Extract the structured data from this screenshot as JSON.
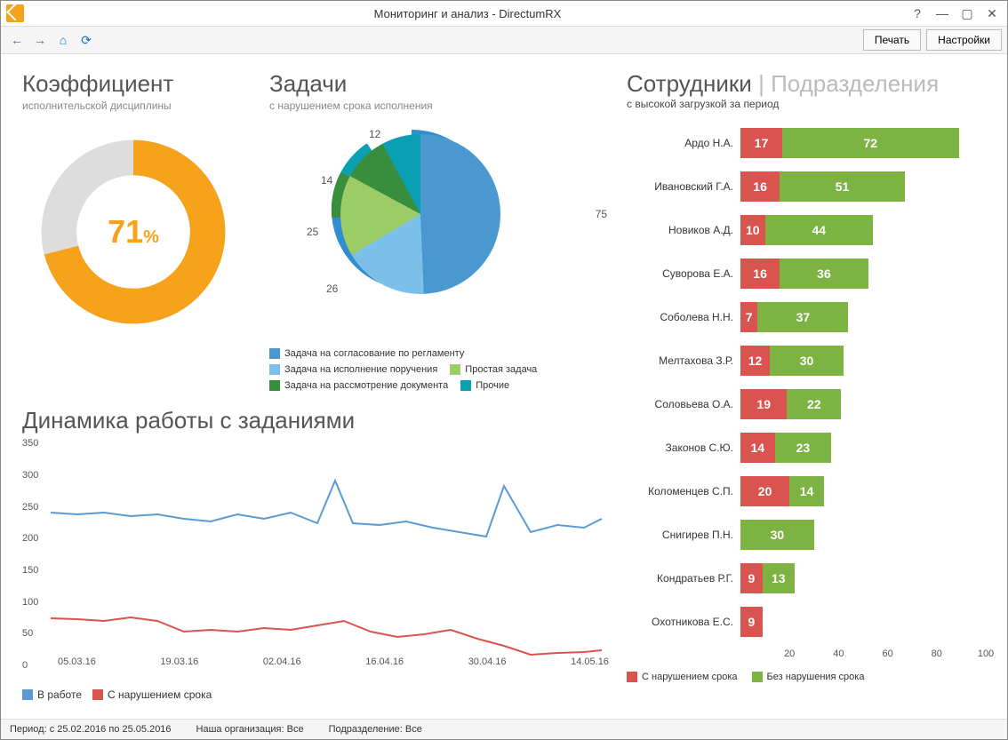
{
  "window": {
    "title": "Мониторинг и анализ - DirectumRX"
  },
  "toolbar": {
    "print_label": "Печать",
    "settings_label": "Настройки"
  },
  "coeff": {
    "title": "Коэффициент",
    "subtitle": "исполнительской дисциплины",
    "value": "71",
    "pct": "%"
  },
  "tasks": {
    "title": "Задачи",
    "subtitle": "с нарушением срока исполнения",
    "legend": [
      "Задача на согласование по регламенту",
      "Задача на исполнение поручения",
      "Простая задача",
      "Задача на рассмотрение документа",
      "Прочие"
    ]
  },
  "dynamics": {
    "title": "Динамика работы с заданиями",
    "legend": [
      "В работе",
      "С нарушением срока"
    ],
    "yticks": [
      "0",
      "50",
      "100",
      "150",
      "200",
      "250",
      "300",
      "350"
    ],
    "xticks": [
      "05.03.16",
      "19.03.16",
      "02.04.16",
      "16.04.16",
      "30.04.16",
      "14.05.16"
    ]
  },
  "employees": {
    "title": "Сотрудники",
    "tab2": "Подразделения",
    "subtitle": "с высокой загрузкой за период",
    "legend": [
      "С нарушением срока",
      "Без нарушения срока"
    ],
    "xticks": [
      "20",
      "40",
      "60",
      "80",
      "100"
    ],
    "rows": [
      {
        "name": "Ардо Н.А.",
        "red": 17,
        "green": 72
      },
      {
        "name": "Ивановский Г.А.",
        "red": 16,
        "green": 51
      },
      {
        "name": "Новиков А.Д.",
        "red": 10,
        "green": 44
      },
      {
        "name": "Суворова Е.А.",
        "red": 16,
        "green": 36
      },
      {
        "name": "Соболева Н.Н.",
        "red": 7,
        "green": 37
      },
      {
        "name": "Мелтахова З.Р.",
        "red": 12,
        "green": 30
      },
      {
        "name": "Соловьева О.А.",
        "red": 19,
        "green": 22
      },
      {
        "name": "Законов С.Ю.",
        "red": 14,
        "green": 23
      },
      {
        "name": "Коломенцев С.П.",
        "red": 20,
        "green": 14
      },
      {
        "name": "Снигирев П.Н.",
        "red": 0,
        "green": 30
      },
      {
        "name": "Кондратьев Р.Г.",
        "red": 9,
        "green": 13
      },
      {
        "name": "Охотникова Е.С.",
        "red": 9,
        "green": 0
      }
    ]
  },
  "statusbar": {
    "period": "Период: с 25.02.2016 по 25.05.2016",
    "org": "Наша организация: Все",
    "dept": "Подразделение: Все"
  },
  "chart_data": [
    {
      "type": "pie",
      "title": "Коэффициент исполнительской дисциплины",
      "series": [
        {
          "name": "donut",
          "values": [
            71,
            29
          ]
        }
      ],
      "note": "donut gauge; 71% completion"
    },
    {
      "type": "pie",
      "title": "Задачи с нарушением срока исполнения",
      "categories": [
        "Задача на согласование по регламенту",
        "Задача на исполнение поручения",
        "Простая задача",
        "Задача на рассмотрение документа",
        "Прочие"
      ],
      "values": [
        75,
        26,
        25,
        14,
        12
      ]
    },
    {
      "type": "line",
      "title": "Динамика работы с заданиями",
      "x": [
        "05.03.16",
        "19.03.16",
        "02.04.16",
        "16.04.16",
        "30.04.16",
        "14.05.16"
      ],
      "series": [
        {
          "name": "В работе",
          "values": [
            240,
            240,
            230,
            235,
            230,
            290,
            220,
            225,
            200,
            280,
            215
          ],
          "note": "approximate envelope, fluctuating around 200-250 with spikes near 290 and 283"
        },
        {
          "name": "С нарушением срока",
          "values": [
            75,
            72,
            55,
            55,
            60,
            65,
            55,
            50,
            30,
            15,
            20
          ],
          "note": "approximate, declining from ~75 to ~20"
        }
      ],
      "ylim": [
        0,
        350
      ]
    },
    {
      "type": "bar",
      "title": "Сотрудники с высокой загрузкой за период",
      "orientation": "horizontal-stacked",
      "categories": [
        "Ардо Н.А.",
        "Ивановский Г.А.",
        "Новиков А.Д.",
        "Суворова Е.А.",
        "Соболева Н.Н.",
        "Мелтахова З.Р.",
        "Соловьева О.А.",
        "Законов С.Ю.",
        "Коломенцев С.П.",
        "Снигирев П.Н.",
        "Кондратьев Р.Г.",
        "Охотникова Е.С."
      ],
      "series": [
        {
          "name": "С нарушением срока",
          "values": [
            17,
            16,
            10,
            16,
            7,
            12,
            19,
            14,
            20,
            0,
            9,
            9
          ]
        },
        {
          "name": "Без нарушения срока",
          "values": [
            72,
            51,
            44,
            36,
            37,
            30,
            22,
            23,
            14,
            30,
            13,
            0
          ]
        }
      ],
      "xlim": [
        0,
        100
      ]
    }
  ]
}
